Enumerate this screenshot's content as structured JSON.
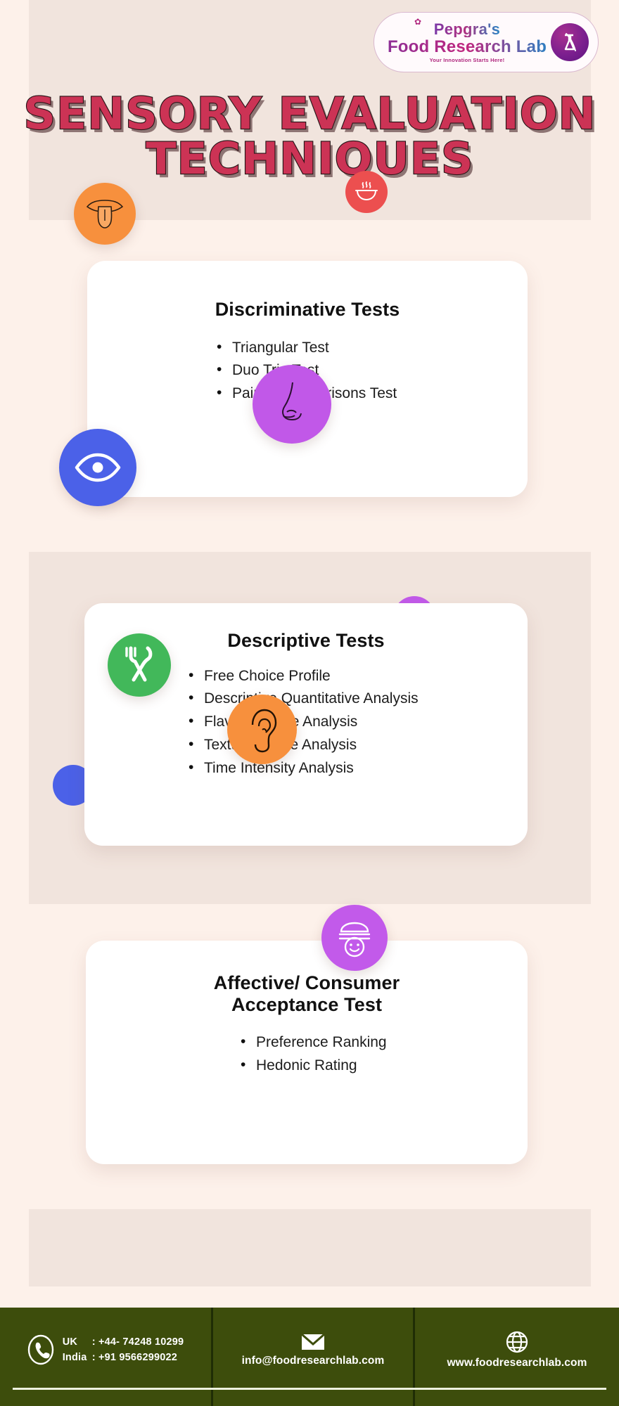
{
  "logo": {
    "line1": "Pepgra's",
    "line2": "Food Research Lab",
    "tagline": "Your Innovation Starts Here!",
    "mark_icon": "flask-r-monogram-icon"
  },
  "header": {
    "title_line_1": "SENSORY EVALUATION",
    "title_line_2": "TECHNIQUES",
    "title_color": "#cc3355",
    "band_color": "#f1e4dd"
  },
  "cards": [
    {
      "title": "Discriminative Tests",
      "items": [
        "Triangular Test",
        "Duo Trio Test",
        "Paired Comparisons Test"
      ]
    },
    {
      "title": "Descriptive Tests",
      "items": [
        "Free Choice Profile",
        "Descriptive Quantitative Analysis",
        "Flavour Profile Analysis",
        "Texture Profile Analysis",
        "Time Intensity Analysis"
      ]
    },
    {
      "title_line_1": "Affective/ Consumer",
      "title_line_2": "Acceptance Test",
      "items": [
        "Preference Ranking",
        "Hedonic Rating"
      ]
    }
  ],
  "icons": [
    {
      "name": "tongue-icon",
      "color": "#f7903d"
    },
    {
      "name": "ramen-bowl-icon",
      "color": "#ec4f4f"
    },
    {
      "name": "nose-icon",
      "color": "#c158e8"
    },
    {
      "name": "eye-icon",
      "color": "#4b61e8"
    },
    {
      "name": "fork-knife-icon",
      "color": "#42b85a"
    },
    {
      "name": "ear-icon",
      "color": "#f7903d"
    },
    {
      "name": "burger-smiley-icon",
      "color": "#c25aea"
    },
    {
      "name": "purple-dot",
      "color": "#c25aea"
    },
    {
      "name": "blue-dot",
      "color": "#4b61e8"
    }
  ],
  "footer": {
    "background": "#3d4d0c",
    "phone": {
      "uk_label": "UK",
      "uk_value": ": +44- 74248 10299",
      "india_label": "India",
      "india_value": ": +91 9566299022"
    },
    "email": "info@foodresearchlab.com",
    "website": "www.foodresearchlab.com"
  }
}
